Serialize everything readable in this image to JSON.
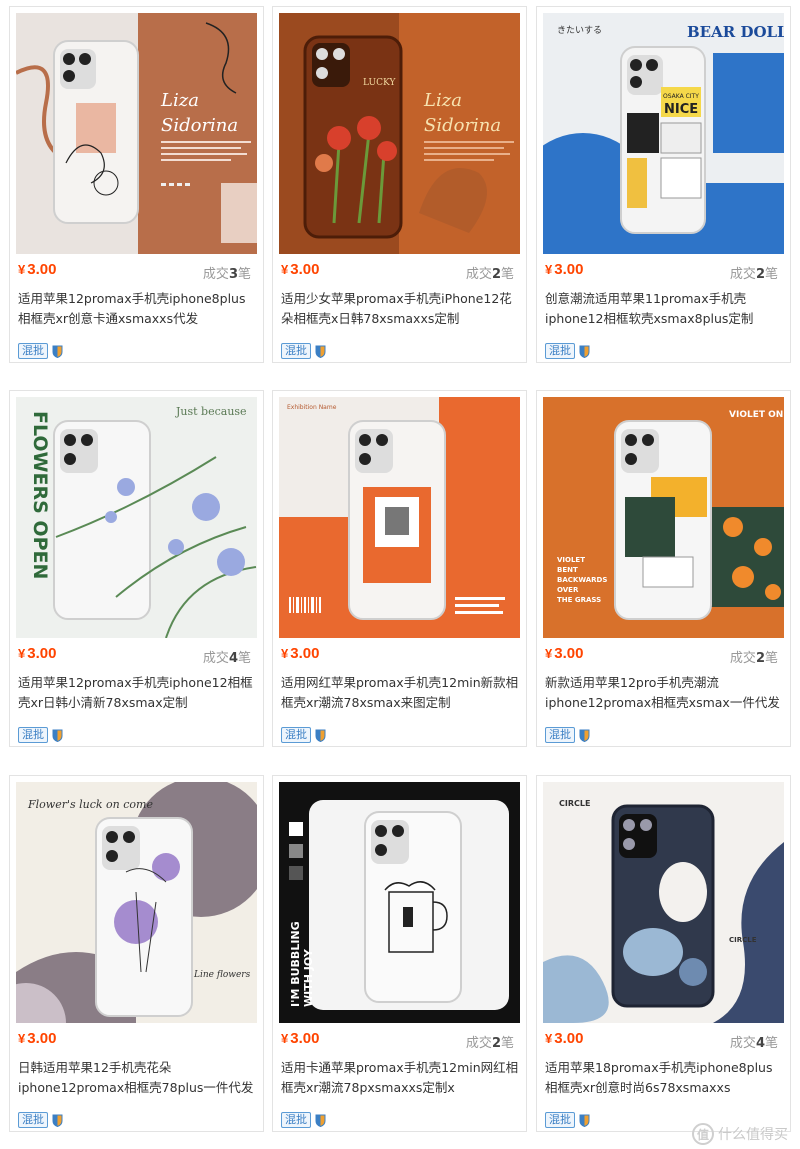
{
  "currency_symbol": "¥",
  "sold_prefix": "成交",
  "sold_suffix": "笔",
  "badge_label": "混批",
  "watermark": "什么值得买",
  "products": [
    {
      "price": "3.00",
      "sold": "3",
      "title": "适用苹果12promax手机壳iphone8plus相框壳xr创意卡通xsmaxxs代发",
      "image": {
        "heading": "Liza Sidorina",
        "icon": "line-art-face-case"
      }
    },
    {
      "price": "3.00",
      "sold": "2",
      "title": "适用少女苹果promax手机壳iPhone12花朵相框壳x日韩78xsmaxxs定制",
      "image": {
        "heading": "Liza Sidorina",
        "badge": "LUCKY",
        "icon": "flower-case"
      }
    },
    {
      "price": "3.00",
      "sold": "2",
      "title": "创意潮流适用苹果11promax手机壳iphone12相框软壳xsmax8plus定制",
      "image": {
        "heading": "BEAR DOLL",
        "sub": "きたいする",
        "tag1": "OSAKA CITY",
        "tag2": "NICE",
        "icon": "ticket-collage-case"
      }
    },
    {
      "price": "3.00",
      "sold": "4",
      "title": "适用苹果12promax手机壳iphone12相框壳xr日韩小清新78xsmax定制",
      "image": {
        "heading": "Just because",
        "side": "FLOWERS OPEN",
        "icon": "lavender-case"
      }
    },
    {
      "price": "3.00",
      "sold": "",
      "title": "适用网红苹果promax手机壳12min新款相框壳xr潮流78xsmax来图定制",
      "image": {
        "heading": "Exhibition Name",
        "icon": "horse-frame-case"
      }
    },
    {
      "price": "3.00",
      "sold": "2",
      "title": "新款适用苹果12pro手机壳潮流iphone12promax相框壳xsmax一件代发",
      "image": {
        "heading": "VIOLET ON",
        "side": "VIOLET BENT BACKWARDS OVER THE GRASS",
        "icon": "orange-collage-case"
      }
    },
    {
      "price": "3.00",
      "sold": "",
      "title": "日韩适用苹果12手机壳花朵iphone12promax相框壳78plus一件代发",
      "image": {
        "heading": "Flower's luck on come",
        "sub": "Line flowers",
        "icon": "line-flower-case"
      }
    },
    {
      "price": "3.00",
      "sold": "2",
      "title": "适用卡通苹果promax手机壳12min网红相框壳xr潮流78pxsmaxxs定制x",
      "image": {
        "heading": "I'M BUBBLING WITH JOY",
        "icon": "beer-mug-case"
      }
    },
    {
      "price": "3.00",
      "sold": "4",
      "title": "适用苹果18promax手机壳iphone8plus相框壳xr创意时尚6s78xsmaxxs",
      "image": {
        "heading": "CIRCLE",
        "sub": "CIRCLE",
        "icon": "abstract-circle-case"
      }
    }
  ]
}
